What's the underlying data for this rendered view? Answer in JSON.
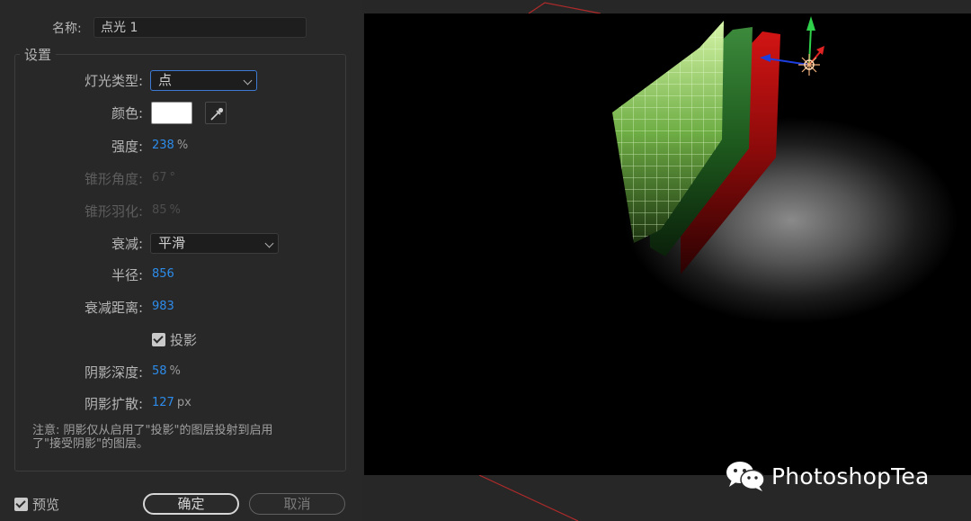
{
  "dialog": {
    "name_label": "名称:",
    "name_value": "点光 1",
    "group_label": "设置",
    "light_type": {
      "label": "灯光类型:",
      "value": "点"
    },
    "color": {
      "label": "颜色:",
      "swatch": "#ffffff"
    },
    "intensity": {
      "label": "强度:",
      "value": "238",
      "unit": "%"
    },
    "cone_angle": {
      "label": "锥形角度:",
      "value": "67",
      "unit": "°"
    },
    "cone_feather": {
      "label": "锥形羽化:",
      "value": "85",
      "unit": "%"
    },
    "falloff": {
      "label": "衰减:",
      "value": "平滑"
    },
    "radius": {
      "label": "半径:",
      "value": "856"
    },
    "falloff_distance": {
      "label": "衰减距离:",
      "value": "983"
    },
    "casts_shadows": {
      "label": "投影",
      "checked": true
    },
    "shadow_darkness": {
      "label": "阴影深度:",
      "value": "58",
      "unit": "%"
    },
    "shadow_diffusion": {
      "label": "阴影扩散:",
      "value": "127",
      "unit": "px"
    },
    "note_line1": "注意: 阴影仅从启用了\"投影\"的图层投射到启用",
    "note_line2": "了\"接受阴影\"的图层。",
    "preview": {
      "label": "预览",
      "checked": true
    },
    "ok_label": "确定",
    "cancel_label": "取消"
  },
  "watermark": {
    "text": "PhotoshopTea",
    "icon": "wechat-icon"
  },
  "colors": {
    "accent_value": "#2d8ceb",
    "focus_border": "#3c7ad3",
    "dialog_bg": "#282828"
  }
}
